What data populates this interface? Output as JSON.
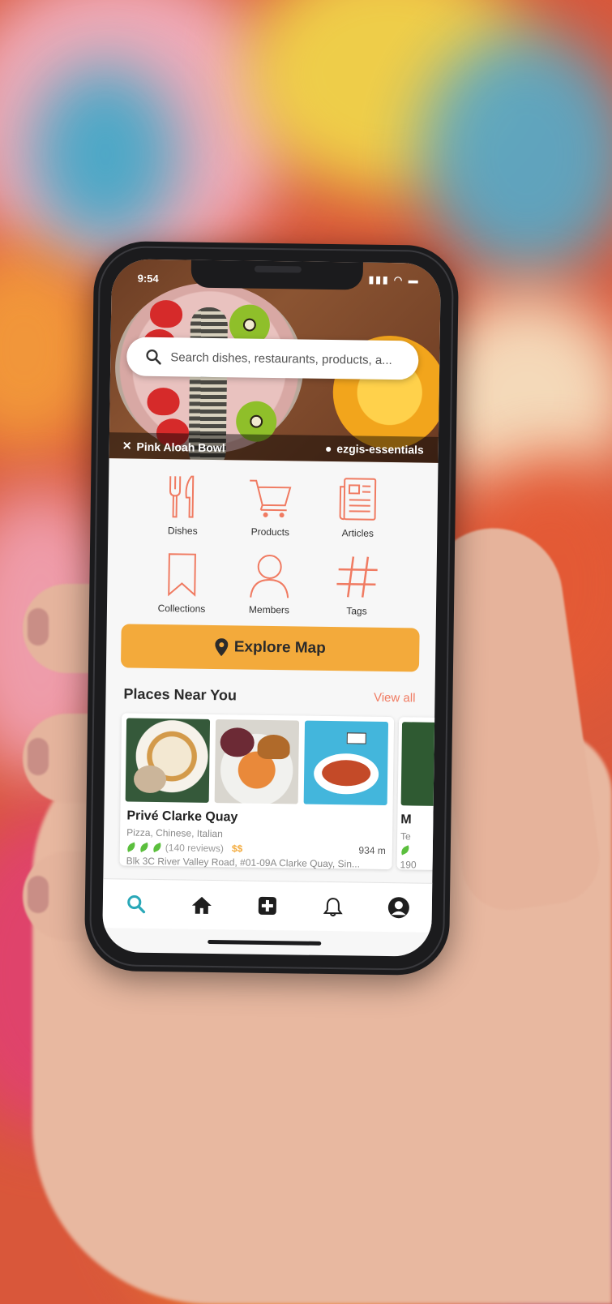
{
  "status": {
    "time": "9:54"
  },
  "search": {
    "placeholder": "Search dishes, restaurants, products, a..."
  },
  "hero": {
    "dish_name": "Pink Aloah Bowl",
    "author": "ezgis-essentials"
  },
  "categories": [
    {
      "label": "Dishes",
      "icon": "fork-knife-icon"
    },
    {
      "label": "Products",
      "icon": "cart-icon"
    },
    {
      "label": "Articles",
      "icon": "newspaper-icon"
    },
    {
      "label": "Collections",
      "icon": "bookmark-icon"
    },
    {
      "label": "Members",
      "icon": "person-icon"
    },
    {
      "label": "Tags",
      "icon": "hashtag-icon"
    }
  ],
  "explore": {
    "label": "Explore Map"
  },
  "places": {
    "title": "Places Near You",
    "view_all": "View all",
    "items": [
      {
        "name": "Privé Clarke Quay",
        "cuisine": "Pizza, Chinese, Italian",
        "reviews": "(140 reviews)",
        "price": "$$",
        "distance": "934 m",
        "address": "Blk 3C River Valley Road, #01-09A Clarke Quay, Sin..."
      },
      {
        "name": "M",
        "cuisine": "Te",
        "address": "190"
      }
    ]
  },
  "tabbar": [
    "search-icon",
    "home-icon",
    "add-icon",
    "bell-icon",
    "profile-icon"
  ],
  "colors": {
    "accent": "#f07b62",
    "button": "#f3aa3b",
    "active_tab": "#2aa8b8",
    "leaf": "#5bbf3d"
  }
}
